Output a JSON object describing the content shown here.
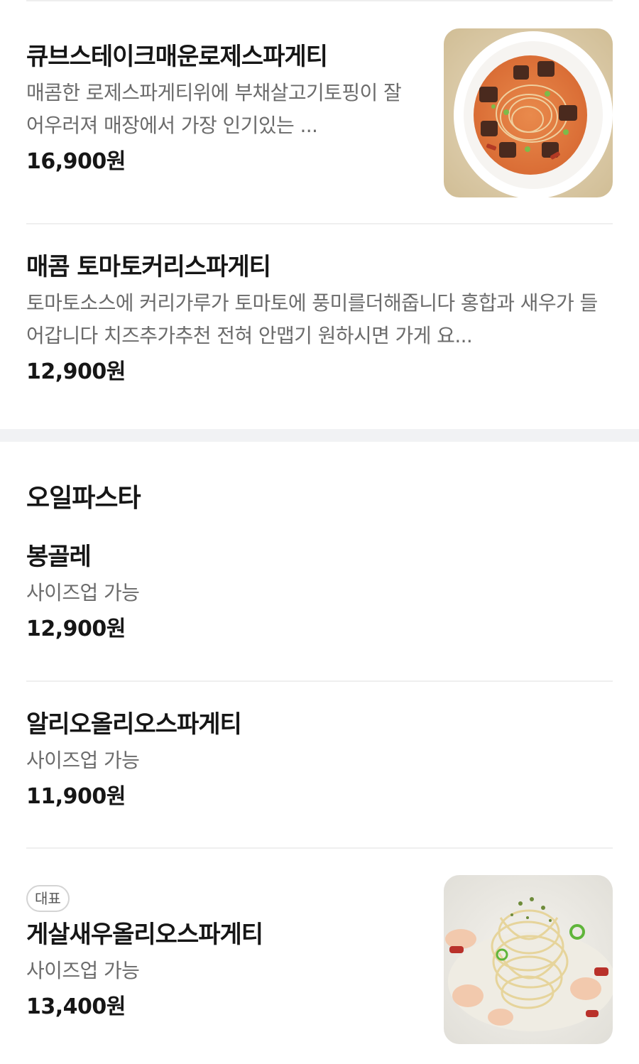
{
  "sections": [
    {
      "items": [
        {
          "name": "큐브스테이크매운로제스파게티",
          "description": "매콤한 로제스파게티위에 부채살고기토핑이 잘어우러져 매장에서 가장 인기있는 ...",
          "price": "16,900원",
          "image": "spicy-rose-pasta-with-steak"
        },
        {
          "name": "매콤 토마토커리스파게티",
          "description": "토마토소스에 커리가루가 토마토에 풍미를더해줍니다 홍합과 새우가 들어갑니다 치즈추가추천 전혀 안맵기 원하시면 가게 요...",
          "price": "12,900원"
        }
      ]
    },
    {
      "title": "오일파스타",
      "items": [
        {
          "name": "봉골레",
          "description": "사이즈업 가능",
          "price": "12,900원"
        },
        {
          "name": "알리오올리오스파게티",
          "description": "사이즈업 가능",
          "price": "11,900원"
        },
        {
          "badge": "대표",
          "name": "게살새우올리오스파게티",
          "description": "사이즈업 가능",
          "price": "13,400원",
          "image": "crab-shrimp-aglio-olio"
        }
      ]
    }
  ],
  "colors": {
    "text": "#161616",
    "description": "#6b6b6b",
    "divider": "#efefef",
    "section_gap": "#f1f2f4"
  }
}
